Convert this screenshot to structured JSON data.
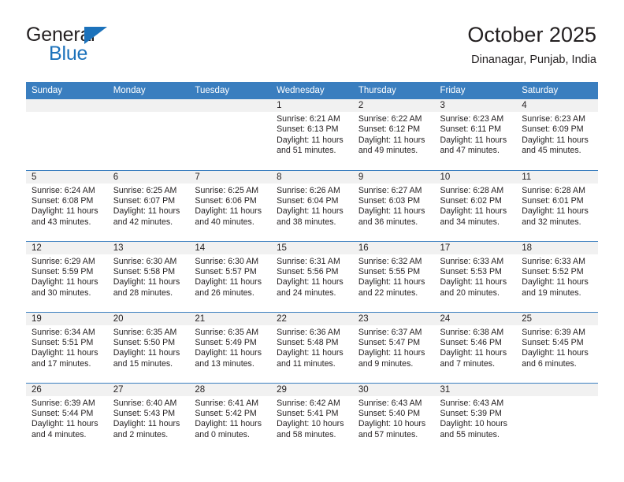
{
  "brand": {
    "word_top": "General",
    "word_bottom": "Blue",
    "color_blue": "#1c72bb"
  },
  "header": {
    "title": "October 2025",
    "subtitle": "Dinanagar, Punjab, India"
  },
  "theme": {
    "header_row_bg": "#3a7ebf",
    "daynum_band_bg": "#f1f1f1",
    "text": "#231f20"
  },
  "weekday_headers": [
    "Sunday",
    "Monday",
    "Tuesday",
    "Wednesday",
    "Thursday",
    "Friday",
    "Saturday"
  ],
  "weeks": [
    [
      {
        "day": "",
        "sunrise": "",
        "sunset": "",
        "daylight_line1": "",
        "daylight_line2": ""
      },
      {
        "day": "",
        "sunrise": "",
        "sunset": "",
        "daylight_line1": "",
        "daylight_line2": ""
      },
      {
        "day": "",
        "sunrise": "",
        "sunset": "",
        "daylight_line1": "",
        "daylight_line2": ""
      },
      {
        "day": "1",
        "sunrise": "Sunrise: 6:21 AM",
        "sunset": "Sunset: 6:13 PM",
        "daylight_line1": "Daylight: 11 hours",
        "daylight_line2": "and 51 minutes."
      },
      {
        "day": "2",
        "sunrise": "Sunrise: 6:22 AM",
        "sunset": "Sunset: 6:12 PM",
        "daylight_line1": "Daylight: 11 hours",
        "daylight_line2": "and 49 minutes."
      },
      {
        "day": "3",
        "sunrise": "Sunrise: 6:23 AM",
        "sunset": "Sunset: 6:11 PM",
        "daylight_line1": "Daylight: 11 hours",
        "daylight_line2": "and 47 minutes."
      },
      {
        "day": "4",
        "sunrise": "Sunrise: 6:23 AM",
        "sunset": "Sunset: 6:09 PM",
        "daylight_line1": "Daylight: 11 hours",
        "daylight_line2": "and 45 minutes."
      }
    ],
    [
      {
        "day": "5",
        "sunrise": "Sunrise: 6:24 AM",
        "sunset": "Sunset: 6:08 PM",
        "daylight_line1": "Daylight: 11 hours",
        "daylight_line2": "and 43 minutes."
      },
      {
        "day": "6",
        "sunrise": "Sunrise: 6:25 AM",
        "sunset": "Sunset: 6:07 PM",
        "daylight_line1": "Daylight: 11 hours",
        "daylight_line2": "and 42 minutes."
      },
      {
        "day": "7",
        "sunrise": "Sunrise: 6:25 AM",
        "sunset": "Sunset: 6:06 PM",
        "daylight_line1": "Daylight: 11 hours",
        "daylight_line2": "and 40 minutes."
      },
      {
        "day": "8",
        "sunrise": "Sunrise: 6:26 AM",
        "sunset": "Sunset: 6:04 PM",
        "daylight_line1": "Daylight: 11 hours",
        "daylight_line2": "and 38 minutes."
      },
      {
        "day": "9",
        "sunrise": "Sunrise: 6:27 AM",
        "sunset": "Sunset: 6:03 PM",
        "daylight_line1": "Daylight: 11 hours",
        "daylight_line2": "and 36 minutes."
      },
      {
        "day": "10",
        "sunrise": "Sunrise: 6:28 AM",
        "sunset": "Sunset: 6:02 PM",
        "daylight_line1": "Daylight: 11 hours",
        "daylight_line2": "and 34 minutes."
      },
      {
        "day": "11",
        "sunrise": "Sunrise: 6:28 AM",
        "sunset": "Sunset: 6:01 PM",
        "daylight_line1": "Daylight: 11 hours",
        "daylight_line2": "and 32 minutes."
      }
    ],
    [
      {
        "day": "12",
        "sunrise": "Sunrise: 6:29 AM",
        "sunset": "Sunset: 5:59 PM",
        "daylight_line1": "Daylight: 11 hours",
        "daylight_line2": "and 30 minutes."
      },
      {
        "day": "13",
        "sunrise": "Sunrise: 6:30 AM",
        "sunset": "Sunset: 5:58 PM",
        "daylight_line1": "Daylight: 11 hours",
        "daylight_line2": "and 28 minutes."
      },
      {
        "day": "14",
        "sunrise": "Sunrise: 6:30 AM",
        "sunset": "Sunset: 5:57 PM",
        "daylight_line1": "Daylight: 11 hours",
        "daylight_line2": "and 26 minutes."
      },
      {
        "day": "15",
        "sunrise": "Sunrise: 6:31 AM",
        "sunset": "Sunset: 5:56 PM",
        "daylight_line1": "Daylight: 11 hours",
        "daylight_line2": "and 24 minutes."
      },
      {
        "day": "16",
        "sunrise": "Sunrise: 6:32 AM",
        "sunset": "Sunset: 5:55 PM",
        "daylight_line1": "Daylight: 11 hours",
        "daylight_line2": "and 22 minutes."
      },
      {
        "day": "17",
        "sunrise": "Sunrise: 6:33 AM",
        "sunset": "Sunset: 5:53 PM",
        "daylight_line1": "Daylight: 11 hours",
        "daylight_line2": "and 20 minutes."
      },
      {
        "day": "18",
        "sunrise": "Sunrise: 6:33 AM",
        "sunset": "Sunset: 5:52 PM",
        "daylight_line1": "Daylight: 11 hours",
        "daylight_line2": "and 19 minutes."
      }
    ],
    [
      {
        "day": "19",
        "sunrise": "Sunrise: 6:34 AM",
        "sunset": "Sunset: 5:51 PM",
        "daylight_line1": "Daylight: 11 hours",
        "daylight_line2": "and 17 minutes."
      },
      {
        "day": "20",
        "sunrise": "Sunrise: 6:35 AM",
        "sunset": "Sunset: 5:50 PM",
        "daylight_line1": "Daylight: 11 hours",
        "daylight_line2": "and 15 minutes."
      },
      {
        "day": "21",
        "sunrise": "Sunrise: 6:35 AM",
        "sunset": "Sunset: 5:49 PM",
        "daylight_line1": "Daylight: 11 hours",
        "daylight_line2": "and 13 minutes."
      },
      {
        "day": "22",
        "sunrise": "Sunrise: 6:36 AM",
        "sunset": "Sunset: 5:48 PM",
        "daylight_line1": "Daylight: 11 hours",
        "daylight_line2": "and 11 minutes."
      },
      {
        "day": "23",
        "sunrise": "Sunrise: 6:37 AM",
        "sunset": "Sunset: 5:47 PM",
        "daylight_line1": "Daylight: 11 hours",
        "daylight_line2": "and 9 minutes."
      },
      {
        "day": "24",
        "sunrise": "Sunrise: 6:38 AM",
        "sunset": "Sunset: 5:46 PM",
        "daylight_line1": "Daylight: 11 hours",
        "daylight_line2": "and 7 minutes."
      },
      {
        "day": "25",
        "sunrise": "Sunrise: 6:39 AM",
        "sunset": "Sunset: 5:45 PM",
        "daylight_line1": "Daylight: 11 hours",
        "daylight_line2": "and 6 minutes."
      }
    ],
    [
      {
        "day": "26",
        "sunrise": "Sunrise: 6:39 AM",
        "sunset": "Sunset: 5:44 PM",
        "daylight_line1": "Daylight: 11 hours",
        "daylight_line2": "and 4 minutes."
      },
      {
        "day": "27",
        "sunrise": "Sunrise: 6:40 AM",
        "sunset": "Sunset: 5:43 PM",
        "daylight_line1": "Daylight: 11 hours",
        "daylight_line2": "and 2 minutes."
      },
      {
        "day": "28",
        "sunrise": "Sunrise: 6:41 AM",
        "sunset": "Sunset: 5:42 PM",
        "daylight_line1": "Daylight: 11 hours",
        "daylight_line2": "and 0 minutes."
      },
      {
        "day": "29",
        "sunrise": "Sunrise: 6:42 AM",
        "sunset": "Sunset: 5:41 PM",
        "daylight_line1": "Daylight: 10 hours",
        "daylight_line2": "and 58 minutes."
      },
      {
        "day": "30",
        "sunrise": "Sunrise: 6:43 AM",
        "sunset": "Sunset: 5:40 PM",
        "daylight_line1": "Daylight: 10 hours",
        "daylight_line2": "and 57 minutes."
      },
      {
        "day": "31",
        "sunrise": "Sunrise: 6:43 AM",
        "sunset": "Sunset: 5:39 PM",
        "daylight_line1": "Daylight: 10 hours",
        "daylight_line2": "and 55 minutes."
      },
      {
        "day": "",
        "sunrise": "",
        "sunset": "",
        "daylight_line1": "",
        "daylight_line2": ""
      }
    ]
  ]
}
